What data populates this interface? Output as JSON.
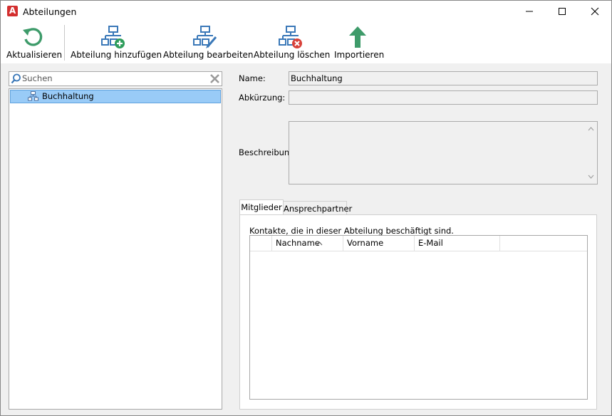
{
  "window": {
    "title": "Abteilungen",
    "app_icon_letter": "A"
  },
  "toolbar": {
    "refresh_label": "Aktualisieren",
    "add_label": "Abteilung hinzufügen",
    "edit_label": "Abteilung bearbeiten",
    "delete_label": "Abteilung löschen",
    "import_label": "Importieren"
  },
  "search": {
    "placeholder": "Suchen",
    "value": ""
  },
  "tree": {
    "items": [
      {
        "label": "Buchhaltung",
        "selected": true
      }
    ]
  },
  "details": {
    "name_label": "Name:",
    "name_value": "Buchhaltung",
    "abbr_label": "Abkürzung:",
    "abbr_value": "",
    "desc_label": "Beschreibung",
    "desc_value": ""
  },
  "tabs": [
    {
      "label": "Mitglieder",
      "active": true
    },
    {
      "label": "Ansprechpartner",
      "active": false
    }
  ],
  "members": {
    "description": "Kontakte, die in dieser Abteilung beschäftigt sind.",
    "columns": [
      "Nachname",
      "Vorname",
      "E-Mail"
    ],
    "sort_indicator": "^",
    "rows": []
  },
  "colors": {
    "selection": "#99cbf7",
    "icon_blue": "#3a78b8",
    "add_green": "#2e9d5b",
    "delete_red": "#d8413a",
    "import_green": "#3e9b6a"
  }
}
